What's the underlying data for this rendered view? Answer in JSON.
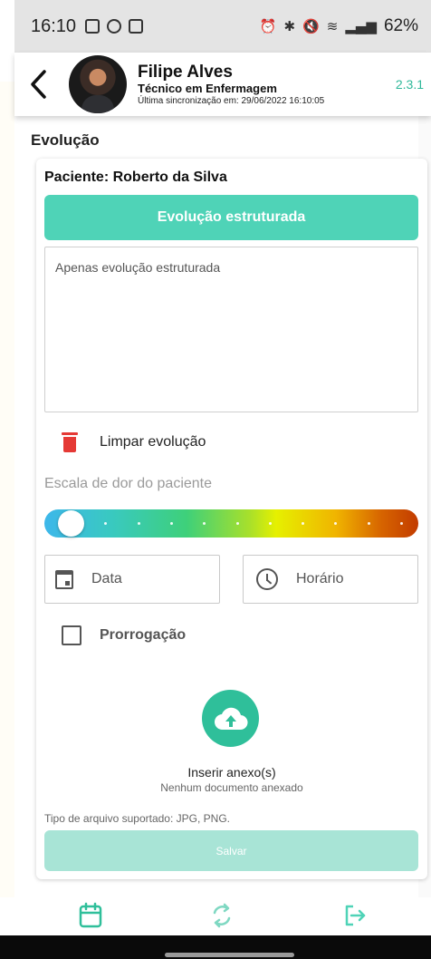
{
  "status_bar": {
    "time": "16:10",
    "battery": "62%"
  },
  "header": {
    "name": "Filipe Alves",
    "role": "Técnico em Enfermagem",
    "sync": "Última sincronização em: 29/06/2022 16:10:05",
    "version": "2.3.1"
  },
  "page": {
    "title": "Evolução"
  },
  "form": {
    "patient": "Paciente: Roberto da Silva",
    "structured_button": "Evolução estruturada",
    "evolution_text": "Apenas evolução estruturada",
    "clear_label": "Limpar evolução",
    "pain_label": "Escala de dor do paciente",
    "pain_level": 0,
    "pain_max": 10,
    "date_placeholder": "Data",
    "time_placeholder": "Horário",
    "prorrogation_label": "Prorrogação",
    "prorrogation_checked": false,
    "attach_label": "Inserir anexo(s)",
    "attach_sub": "Nenhum documento anexado",
    "file_types": "Tipo de arquivo suportado: JPG, PNG.",
    "save_label": "Salvar"
  },
  "colors": {
    "accent": "#4fd3b7",
    "accent_dark": "#2fbf9a",
    "save_disabled": "#a8e4d6",
    "danger": "#e53935"
  },
  "icons": {
    "back": "chevron-left-icon",
    "trash": "trash-icon",
    "calendar": "calendar-icon",
    "clock": "clock-icon",
    "upload": "cloud-upload-icon",
    "nav_calendar": "calendar-icon",
    "nav_sync": "sync-icon",
    "nav_exit": "logout-icon"
  }
}
